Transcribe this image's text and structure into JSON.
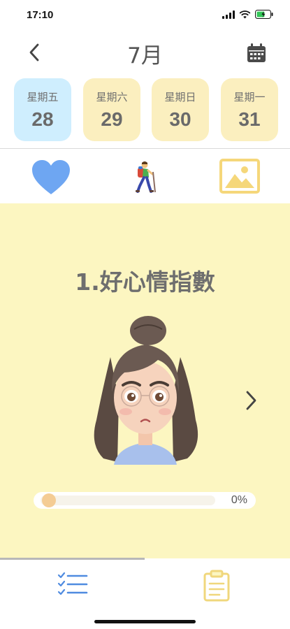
{
  "status_bar": {
    "time": "17:10",
    "icons": [
      "signal-icon",
      "wifi-icon",
      "battery-charging-icon"
    ]
  },
  "header": {
    "month": "7月",
    "back_icon": "chevron-left-icon",
    "calendar_icon": "calendar-icon"
  },
  "days": [
    {
      "weekday": "星期五",
      "date": "28",
      "selected": true
    },
    {
      "weekday": "星期六",
      "date": "29",
      "selected": false
    },
    {
      "weekday": "星期日",
      "date": "30",
      "selected": false
    },
    {
      "weekday": "星期一",
      "date": "31",
      "selected": false
    }
  ],
  "mode_tabs": [
    "heart-icon",
    "hiker-icon",
    "photo-icon"
  ],
  "card": {
    "title": "1.好心情指數",
    "image": "worried-girl-avatar",
    "progress_label": "0%",
    "progress_value": 0
  },
  "bottom_nav": [
    "checklist-icon",
    "clipboard-icon"
  ],
  "colors": {
    "panel_bg": "#fcf6c1",
    "day_card": "#fbefbf",
    "day_card_selected": "#cfeefe",
    "heart": "#6ea6f2",
    "photo": "#f5d77a",
    "list": "#4f8be0",
    "clipboard": "#f0d77c",
    "progress_knob": "#f4cc94"
  }
}
